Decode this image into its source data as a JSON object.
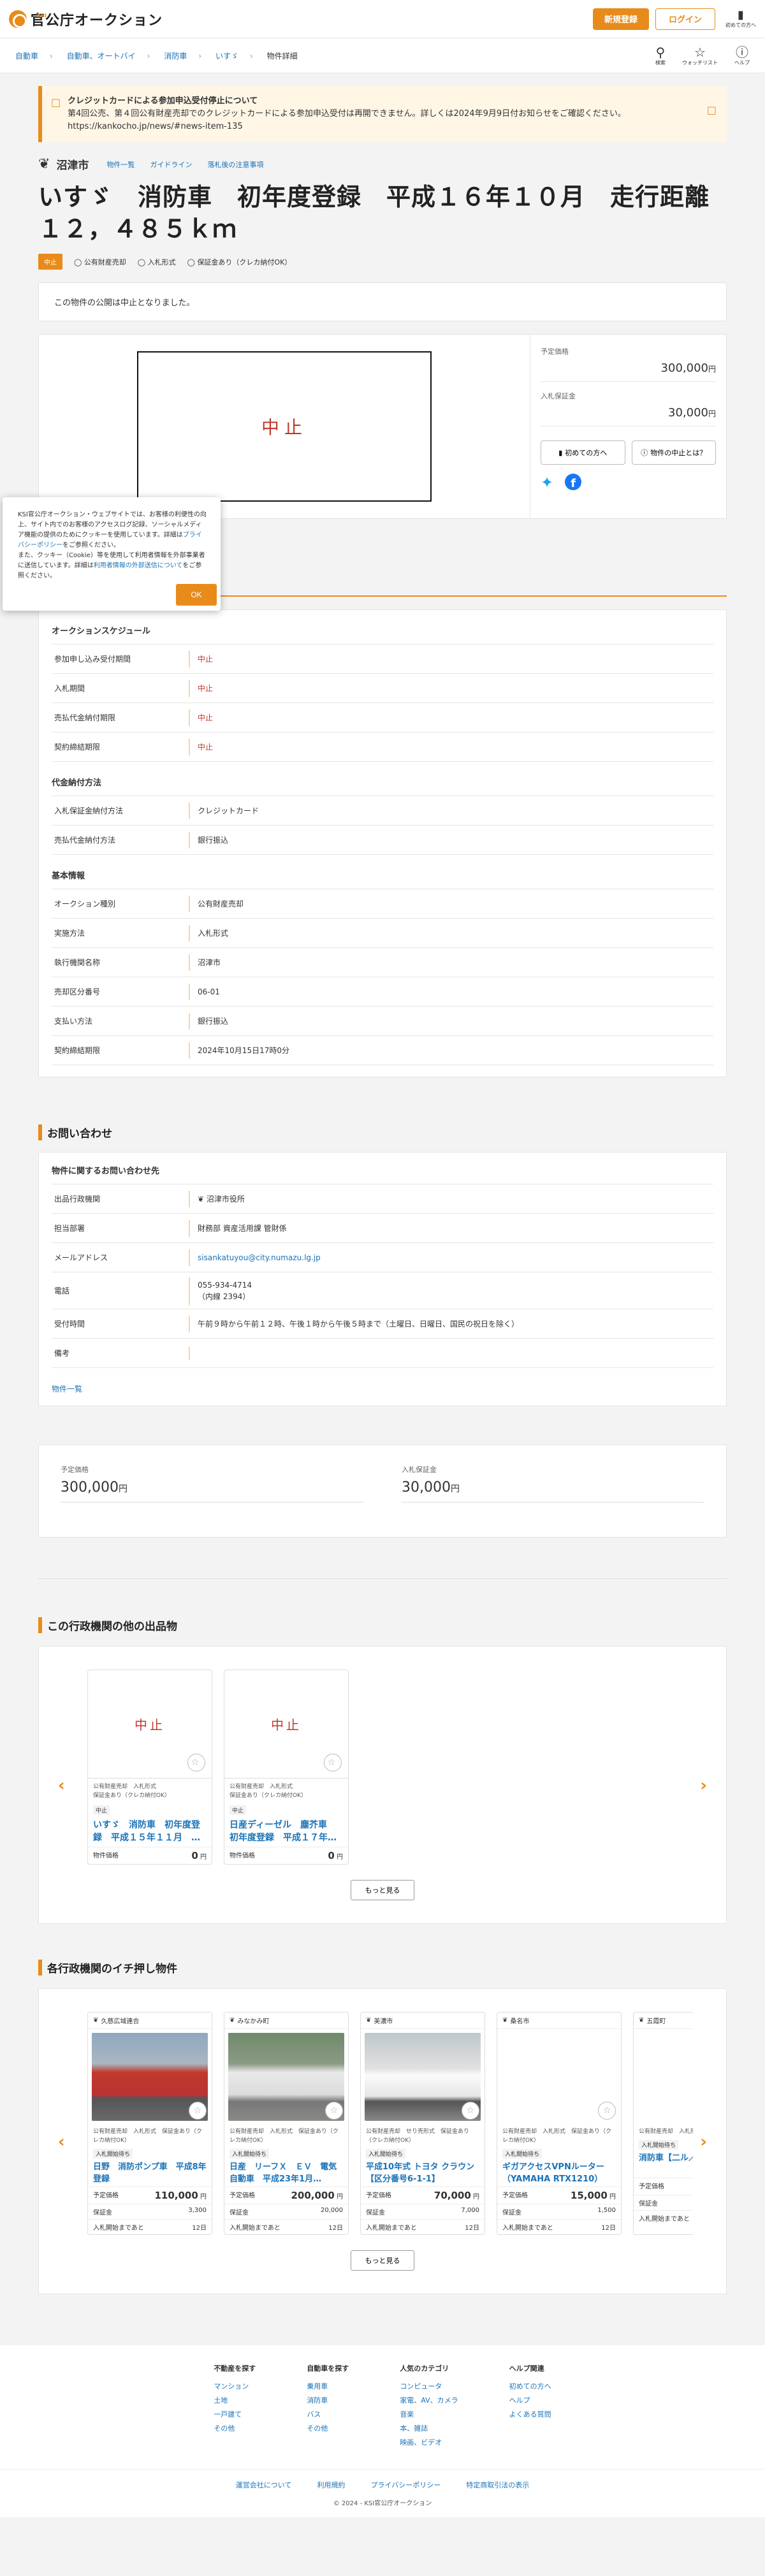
{
  "header": {
    "logo_small": "KSI",
    "logo_text": "官公庁オークション",
    "register": "新規登録",
    "login": "ログイン",
    "first_time": "初めての方へ"
  },
  "breadcrumb": [
    "自動車",
    "自動車、オートバイ",
    "消防車",
    "いすゞ",
    "物件詳細"
  ],
  "subnav_icons": [
    "検索",
    "ウォッチリスト",
    "ヘルプ"
  ],
  "notice": {
    "title": "クレジットカードによる参加申込受付停止について",
    "body": "第4回公売、第４回公有財産売却でのクレジットカードによる参加申込受付は再開できません。詳しくは2024年9月9日付お知らせをご確認ください。",
    "url": "https://kankocho.jp/news/#news-item-135"
  },
  "org": {
    "name": "沼津市",
    "links": [
      "物件一覧",
      "ガイドライン",
      "落札後の注意事項"
    ]
  },
  "item": {
    "title": "いすゞ　消防車　初年度登録　平成１６年１０月　走行距離１２，４８５ｋｍ",
    "status_tag": "中止",
    "tags": [
      "公有財産売却",
      "入札形式",
      "保証金あり（クレカ納付OK）"
    ],
    "message": "この物件の公開は中止となりました。",
    "image_text": "中止"
  },
  "price": {
    "expected_label": "予定価格",
    "expected": "300,000",
    "deposit_label": "入札保証金",
    "deposit": "30,000",
    "unit": "円",
    "btn_first": "初めての方へ",
    "btn_stop": "物件の中止とは？"
  },
  "cookie": {
    "text1": "KSI官公庁オークション・ウェブサイトでは、お客様の利便性の向上、サイト内でのお客様のアクセスログ記録、ソーシャルメディア機能の提供のためにクッキーを使用しています。詳細は",
    "link1": "プライバシーポリシー",
    "text2": "をご参照ください。",
    "text3": "また、クッキー（Cookie）等を使用して利用者情報を外部事業者に送信しています。詳細は",
    "link2": "利用者情報の外部送信について",
    "text4": "をご参照ください。",
    "ok": "OK"
  },
  "schedule": {
    "title": "オークションスケジュール",
    "rows": [
      {
        "k": "参加申し込み受付期間",
        "v": "中止"
      },
      {
        "k": "入札期間",
        "v": "中止"
      },
      {
        "k": "売払代金納付期限",
        "v": "中止"
      },
      {
        "k": "契約締結期限",
        "v": "中止"
      }
    ]
  },
  "payment": {
    "title": "代金納付方法",
    "rows": [
      {
        "k": "入札保証金納付方法",
        "v": "クレジットカード"
      },
      {
        "k": "売払代金納付方法",
        "v": "銀行振込"
      }
    ]
  },
  "basic": {
    "title": "基本情報",
    "rows": [
      {
        "k": "オークション種別",
        "v": "公有財産売却"
      },
      {
        "k": "実施方法",
        "v": "入札形式"
      },
      {
        "k": "執行機関名称",
        "v": "沼津市"
      },
      {
        "k": "売却区分番号",
        "v": "06-01"
      },
      {
        "k": "支払い方法",
        "v": "銀行振込"
      },
      {
        "k": "契約締結期限",
        "v": "2024年10月15日17時0分"
      }
    ]
  },
  "inquiry": {
    "heading": "お問い合わせ",
    "title": "物件に関するお問い合わせ先",
    "org_label": "出品行政機関",
    "org": "沼津市役所",
    "dept_label": "担当部署",
    "dept": "財務部 資産活用課 管財係",
    "mail_label": "メールアドレス",
    "mail": "sisankatuyou@city.numazu.lg.jp",
    "tel_label": "電話",
    "tel": "055-934-4714",
    "ext": "（内線 2394）",
    "hours_label": "受付時間",
    "hours": "午前９時から午前１２時、午後１時から午後５時まで（土曜日、日曜日、国民の祝日を除く）",
    "note_label": "備考",
    "note": "",
    "all_items": "物件一覧"
  },
  "summary": {
    "expected_label": "予定価格",
    "expected": "300,000",
    "deposit_label": "入札保証金",
    "deposit": "30,000",
    "unit": "円"
  },
  "other": {
    "heading": "この行政機関の他の出品物",
    "more": "もっと見る",
    "cards": [
      {
        "img": "中止",
        "meta1": "公有財産売却",
        "meta2": "入札形式",
        "meta3": "保証金あり（クレカ納付OK）",
        "badge": "中止",
        "title": "いすゞ　消防車　初年度登録　平成１５年１１月　…",
        "price_label": "物件価格",
        "price": "0",
        "unit": "円"
      },
      {
        "img": "中止",
        "meta1": "公有財産売却",
        "meta2": "入札形式",
        "meta3": "保証金あり（クレカ納付OK）",
        "badge": "中止",
        "title": "日産ディーゼル　塵芥車　初年度登録　平成１７年…",
        "price_label": "物件価格",
        "price": "0",
        "unit": "円"
      }
    ]
  },
  "pickup": {
    "heading": "各行政機関のイチ押し物件",
    "more": "もっと見る",
    "cards": [
      {
        "org": "久慈広域連合",
        "photo": "ph-truck",
        "tags": "公有財産売却　入札形式　保証金あり（クレカ納付OK）",
        "badge": "入札開始待ち",
        "title": "日野　消防ポンプ車　平成8年登録",
        "price_label": "予定価格",
        "price": "110,000",
        "dep_label": "保証金",
        "dep": "3,300",
        "days_label": "入札開始まであと",
        "days": "12日"
      },
      {
        "org": "みなかみ町",
        "photo": "ph-car1",
        "tags": "公有財産売却　入札形式　保証金あり（クレカ納付OK）",
        "badge": "入札開始待ち",
        "title": "日産　リーフＸ　ＥＶ　電気自動車　平成23年1月…",
        "price_label": "予定価格",
        "price": "200,000",
        "dep_label": "保証金",
        "dep": "20,000",
        "days_label": "入札開始まであと",
        "days": "12日"
      },
      {
        "org": "美濃市",
        "photo": "ph-car2",
        "tags": "公有財産売却　せり売形式　保証金あり（クレカ納付OK）",
        "badge": "入札開始待ち",
        "title": "平成10年式 トヨタ クラウン【区分番号6-1-1】",
        "price_label": "予定価格",
        "price": "70,000",
        "dep_label": "保証金",
        "dep": "7,000",
        "days_label": "入札開始まであと",
        "days": "12日"
      },
      {
        "org": "桑名市",
        "photo": "ph-none",
        "tags": "公有財産売却　入札形式　保証金あり（クレカ納付OK）",
        "badge": "入札開始待ち",
        "title": "ギガアクセスVPNルーター（YAMAHA RTX1210）",
        "price_label": "予定価格",
        "price": "15,000",
        "dep_label": "保証金",
        "dep": "1,500",
        "days_label": "入札開始まであと",
        "days": "12日"
      },
      {
        "org": "五霞町",
        "photo": "ph-none",
        "tags": "公有財産売却　入札形式　保証金あり",
        "badge": "入札開始待ち",
        "title": "消防車【二ル／一時移",
        "price_label": "予定価格",
        "price": "",
        "dep_label": "保証金",
        "dep": "",
        "days_label": "入札開始まであと",
        "days": ""
      }
    ]
  },
  "footer": {
    "cols": [
      {
        "h": "不動産を探す",
        "items": [
          "マンション",
          "土地",
          "一戸建て",
          "その他"
        ]
      },
      {
        "h": "自動車を探す",
        "items": [
          "乗用車",
          "消防車",
          "バス",
          "その他"
        ]
      },
      {
        "h": "人気のカテゴリ",
        "items": [
          "コンピュータ",
          "家電、AV、カメラ",
          "音楽",
          "本、雑誌",
          "映画、ビデオ"
        ]
      },
      {
        "h": "ヘルプ関連",
        "items": [
          "初めての方へ",
          "ヘルプ",
          "よくある質問"
        ]
      }
    ],
    "bottom": [
      "運営会社について",
      "利用規約",
      "プライバシーポリシー",
      "特定商取引法の表示"
    ],
    "copy": "© 2024 - KSI官公庁オークション"
  }
}
